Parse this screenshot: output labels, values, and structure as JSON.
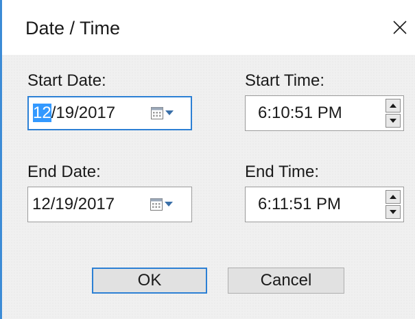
{
  "dialog": {
    "title": "Date / Time",
    "close_glyph": "✕"
  },
  "start_date": {
    "label": "Start Date:",
    "selected_part": "12",
    "rest": "/19/2017",
    "icon": "calendar-icon"
  },
  "start_time": {
    "label": "Start Time:",
    "value": "6:10:51 PM"
  },
  "end_date": {
    "label": "End Date:",
    "value": "12/19/2017",
    "icon": "calendar-icon"
  },
  "end_time": {
    "label": "End Time:",
    "value": "6:11:51 PM"
  },
  "buttons": {
    "ok": "OK",
    "cancel": "Cancel"
  },
  "colors": {
    "accent": "#2b7fd4",
    "selection": "#3399ff"
  }
}
